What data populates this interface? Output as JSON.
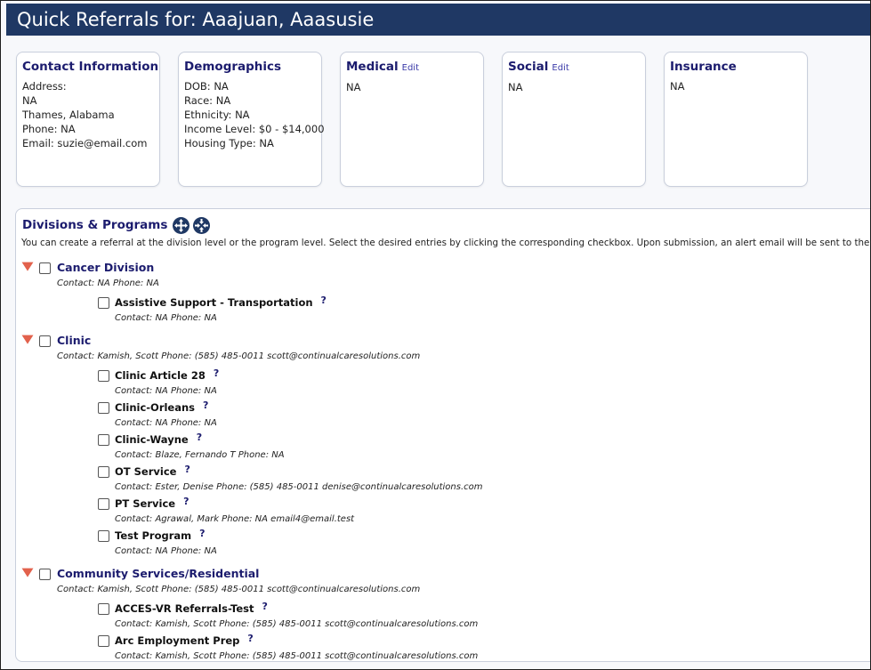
{
  "title": "Quick Referrals for: Aaajuan, Aaasusie",
  "cards": {
    "contact": {
      "title": "Contact Information",
      "lines": [
        "Address:",
        "NA",
        "Thames, Alabama",
        "Phone: NA",
        "Email: suzie@email.com"
      ]
    },
    "demographics": {
      "title": "Demographics",
      "lines": [
        "DOB: NA",
        "Race: NA",
        "Ethnicity: NA",
        "Income Level: $0 - $14,000",
        "Housing Type: NA"
      ]
    },
    "medical": {
      "title": "Medical",
      "edit": "Edit",
      "lines": [
        "NA"
      ]
    },
    "social": {
      "title": "Social",
      "edit": "Edit",
      "lines": [
        "NA"
      ]
    },
    "insurance": {
      "title": "Insurance",
      "lines": [
        "NA"
      ]
    }
  },
  "divisions_panel": {
    "title": "Divisions & Programs",
    "description": "You can create a referral at the division level or the program level. Select the desired entries by clicking the corresponding checkbox. Upon submission, an alert email will be sent to the primary contact.",
    "help_glyph": "?",
    "divisions": [
      {
        "name": "Cancer Division",
        "contact": "Contact: NA Phone: NA",
        "programs": [
          {
            "name": "Assistive Support - Transportation",
            "contact": "Contact: NA Phone: NA"
          }
        ]
      },
      {
        "name": "Clinic",
        "contact": "Contact: Kamish, Scott Phone: (585) 485-0011 scott@continualcaresolutions.com",
        "programs": [
          {
            "name": "Clinic Article 28",
            "contact": "Contact: NA Phone: NA"
          },
          {
            "name": "Clinic-Orleans",
            "contact": "Contact: NA Phone: NA"
          },
          {
            "name": "Clinic-Wayne",
            "contact": "Contact: Blaze, Fernando T Phone: NA"
          },
          {
            "name": "OT Service",
            "contact": "Contact: Ester, Denise Phone: (585) 485-0011 denise@continualcaresolutions.com"
          },
          {
            "name": "PT Service",
            "contact": "Contact: Agrawal, Mark Phone: NA email4@email.test"
          },
          {
            "name": "Test Program",
            "contact": "Contact: NA Phone: NA"
          }
        ]
      },
      {
        "name": "Community Services/Residential",
        "contact": "Contact: Kamish, Scott Phone: (585) 485-0011 scott@continualcaresolutions.com",
        "programs": [
          {
            "name": "ACCES-VR Referrals-Test",
            "contact": "Contact: Kamish, Scott Phone: (585) 485-0011 scott@continualcaresolutions.com"
          },
          {
            "name": "Arc Employment Prep",
            "contact": "Contact: Kamish, Scott Phone: (585) 485-0011 scott@continualcaresolutions.com"
          }
        ]
      }
    ]
  },
  "colors": {
    "header_bg": "#1f3864",
    "heading_text": "#1c1c6e",
    "caret": "#e2614c"
  },
  "icons": {
    "expand_all": "expand-all-icon",
    "collapse_all": "collapse-all-icon",
    "caret": "chevron-down-icon"
  }
}
